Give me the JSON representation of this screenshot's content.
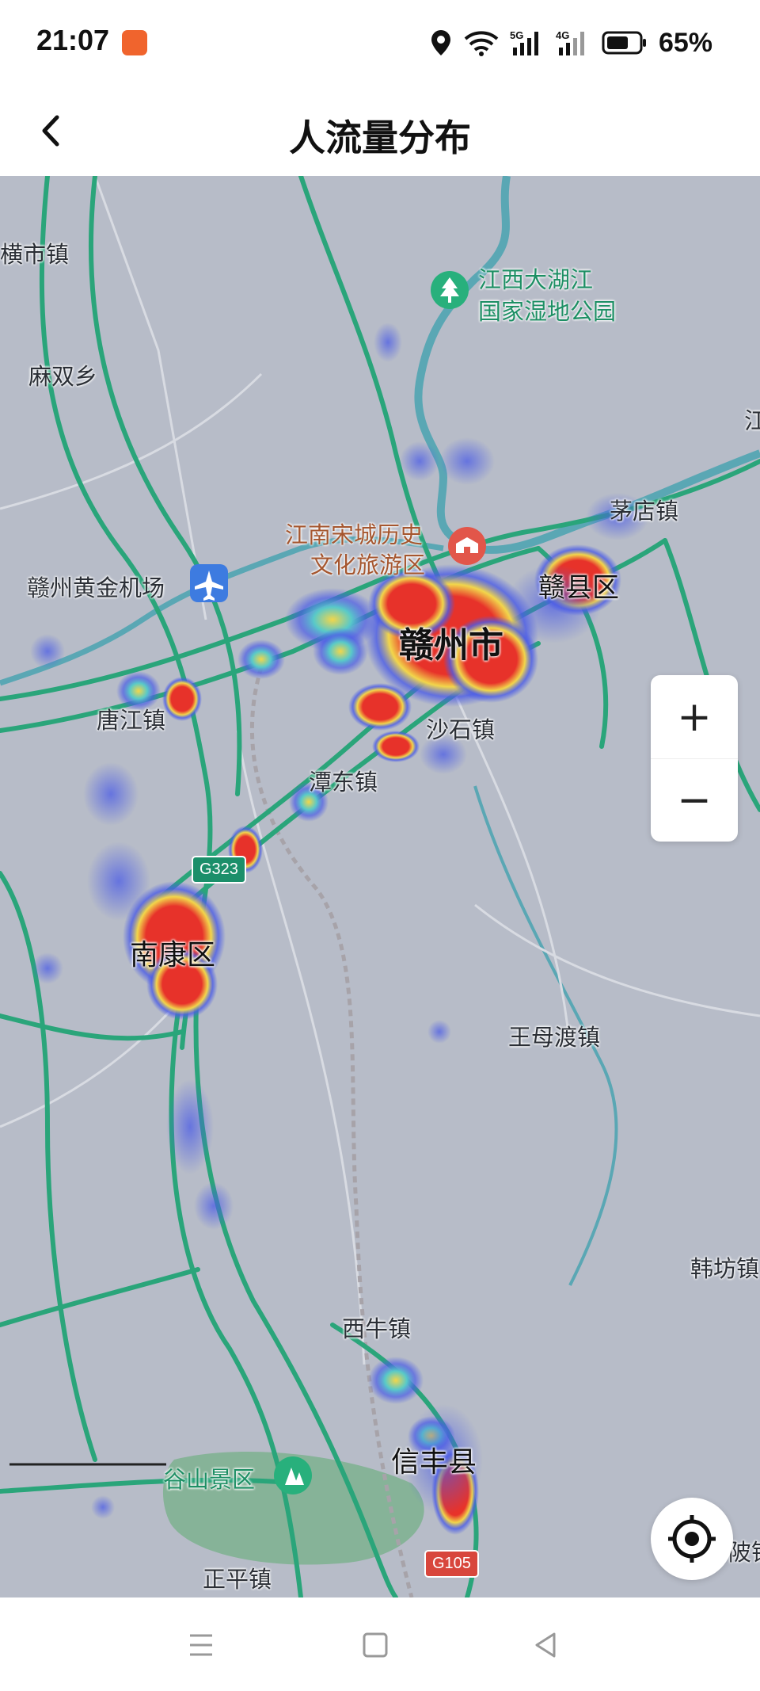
{
  "status": {
    "time": "21:07",
    "battery": "65%"
  },
  "header": {
    "title": "人流量分布"
  },
  "map": {
    "labels": {
      "heng_shi": "横市镇",
      "ma_shuang": "麻双乡",
      "wetland_1": "江西大湖江",
      "wetland_2": "国家湿地公园",
      "songcheng_1": "江南宋城历史",
      "songcheng_2": "文化旅游区",
      "maodian": "茅店镇",
      "airport": "赣州黄金机场",
      "ganzhou": "赣州市",
      "ganxian": "赣县区",
      "tangjiang": "唐江镇",
      "shashi": "沙石镇",
      "tandong": "潭东镇",
      "nankang": "南康区",
      "wangmudu": "王母渡镇",
      "xiniu": "西牛镇",
      "hanfang": "韩坊镇",
      "xinfeng": "信丰县",
      "gushan": "谷山景区",
      "zhengping": "正平镇",
      "edge_bo": "陂镇",
      "edge_jiang": "江"
    },
    "shields": {
      "g323": "G323",
      "g105": "G105"
    },
    "colors": {
      "background": "#b7bcc8",
      "road": "#2aa57a",
      "river": "#5aa7b4",
      "heat_low": "#4b5ce6",
      "heat_mid": "#f2d64b",
      "heat_high": "#e7322a"
    }
  },
  "controls": {
    "zoom_in": "+",
    "zoom_out": "−"
  }
}
